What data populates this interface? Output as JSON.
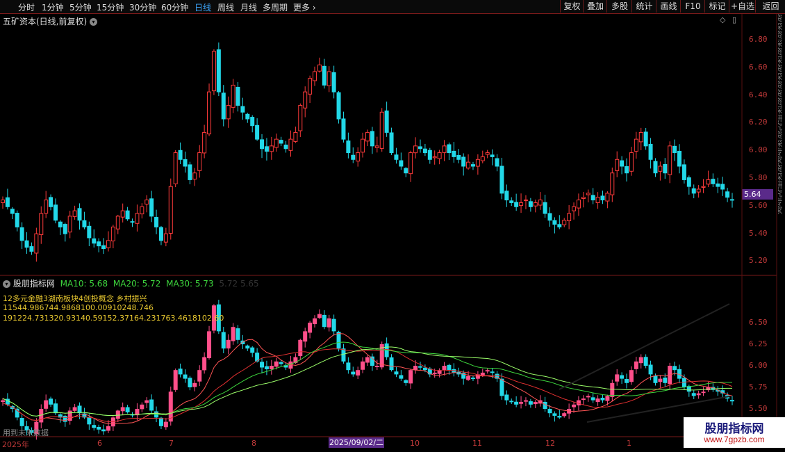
{
  "toolbar": {
    "periods": [
      "分时",
      "1分钟",
      "5分钟",
      "15分钟",
      "30分钟",
      "60分钟",
      "日线",
      "周线",
      "月线",
      "多周期",
      "更多"
    ],
    "active_period": "日线",
    "right_buttons": [
      "复权",
      "叠加",
      "多股",
      "统计",
      "画线",
      "F10",
      "标记",
      "+自选",
      "返回"
    ]
  },
  "main_chart": {
    "title": "五矿资本(日线,前复权)",
    "y_ticks": [
      "6.80",
      "6.60",
      "6.40",
      "6.20",
      "6.00",
      "5.80",
      "5.60",
      "5.40",
      "5.20"
    ],
    "current_price": "5.64"
  },
  "indicator": {
    "name": "股朋指标网",
    "ma10": "MA10: 5.68",
    "ma20": "MA20: 5.72",
    "ma30": "MA30: 5.73",
    "extra": "5.72  5.65",
    "line1": "12多元金融3湖南板块4创投概念 乡村振兴",
    "line2": "11544.986744.9868100.00910248.746",
    "line3": "191224.731320.93140.59152.37164.231763.4618102.60",
    "y_ticks": [
      "6.50",
      "6.25",
      "6.00",
      "5.75",
      "5.50"
    ],
    "footer_hint": "用到未来数据"
  },
  "x_axis": {
    "labels": [
      "2025年",
      "6",
      "7",
      "8",
      "9",
      "10",
      "11",
      "12",
      "1"
    ],
    "cursor_date": "2025/09/02/二"
  },
  "watermark": {
    "title": "股朋指标网",
    "url": "www.7gpzb.com"
  },
  "colors": {
    "up": "#ff3b3b",
    "down": "#22d8e8",
    "ma_green": "#3dd63d",
    "ma_red": "#e03030"
  },
  "chart_data": {
    "type": "candlestick",
    "ylim": [
      5.15,
      6.9
    ],
    "series": [
      {
        "name": "price",
        "values": [
          5.6,
          5.55,
          5.5,
          5.4,
          5.3,
          5.25,
          5.22,
          5.35,
          5.5,
          5.6,
          5.55,
          5.45,
          5.4,
          5.35,
          5.48,
          5.52,
          5.45,
          5.4,
          5.32,
          5.28,
          5.26,
          5.24,
          5.3,
          5.4,
          5.48,
          5.52,
          5.46,
          5.44,
          5.5,
          5.55,
          5.6,
          5.48,
          5.4,
          5.3,
          5.35,
          5.7,
          5.95,
          5.9,
          5.85,
          5.75,
          5.8,
          5.95,
          6.1,
          6.4,
          6.7,
          6.4,
          6.2,
          6.3,
          6.45,
          6.3,
          6.25,
          6.2,
          6.15,
          6.05,
          5.98,
          5.96,
          6.0,
          6.05,
          6.02,
          5.98,
          6.05,
          6.1,
          6.3,
          6.4,
          6.5,
          6.55,
          6.6,
          6.45,
          6.55,
          6.4,
          6.2,
          6.05,
          5.95,
          5.9,
          5.95,
          6.05,
          6.1,
          6.0,
          6.0,
          6.25,
          6.1,
          5.95,
          5.9,
          5.85,
          5.8,
          5.95,
          6.0,
          5.98,
          5.95,
          5.9,
          5.92,
          5.95,
          6.0,
          5.95,
          5.92,
          5.9,
          5.85,
          5.88,
          5.85,
          5.9,
          5.92,
          5.95,
          5.92,
          5.85,
          5.65,
          5.6,
          5.58,
          5.55,
          5.58,
          5.6,
          5.55,
          5.58,
          5.6,
          5.5,
          5.45,
          5.42,
          5.4,
          5.45,
          5.5,
          5.55,
          5.6,
          5.62,
          5.65,
          5.6,
          5.62,
          5.6,
          5.65,
          5.8,
          5.9,
          5.85,
          5.8,
          5.95,
          6.05,
          6.1,
          6.0,
          5.9,
          5.8,
          5.85,
          5.8,
          6.0,
          5.95,
          5.85,
          5.75,
          5.7,
          5.65,
          5.68,
          5.7,
          5.75,
          5.72,
          5.7,
          5.68,
          5.62,
          5.6
        ]
      }
    ]
  }
}
